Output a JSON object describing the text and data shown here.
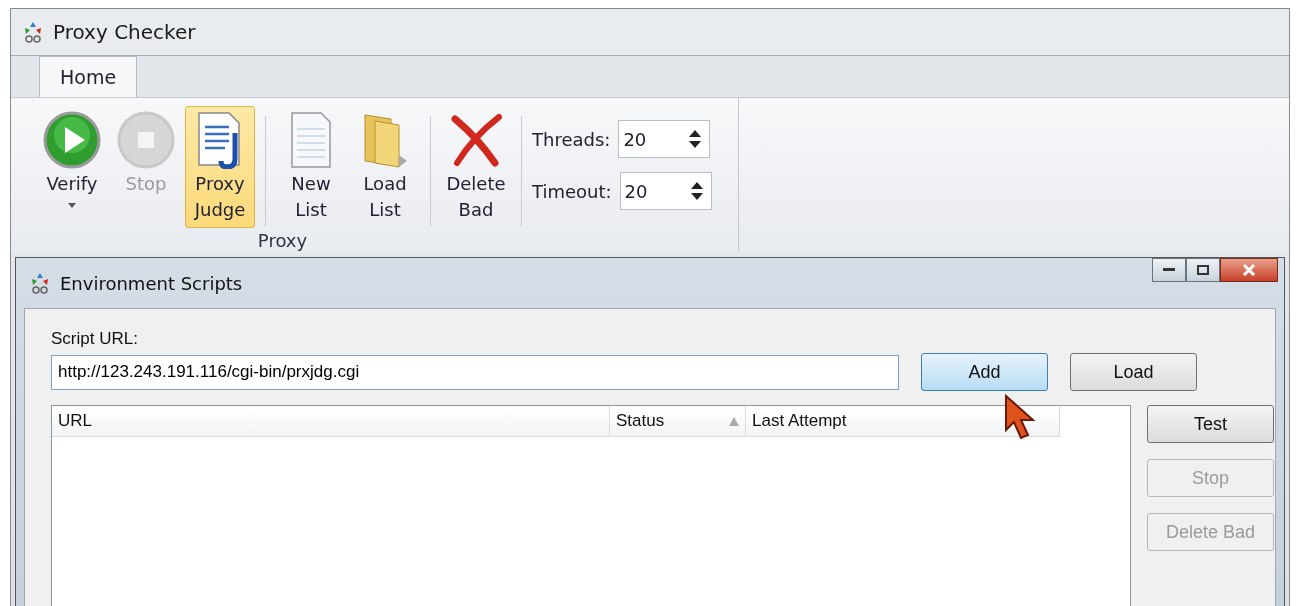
{
  "window": {
    "title": "Proxy Checker"
  },
  "ribbon": {
    "tabs": [
      {
        "label": "Home",
        "selected": true
      }
    ],
    "buttons": [
      {
        "label": "Verify",
        "disabled": false,
        "pressed": false,
        "dropdown": true
      },
      {
        "label": "Stop",
        "disabled": true,
        "pressed": false,
        "dropdown": false
      },
      {
        "label": "Proxy Judge",
        "disabled": false,
        "pressed": true,
        "dropdown": false
      },
      {
        "label": "New List",
        "disabled": false,
        "pressed": false,
        "dropdown": false
      },
      {
        "label": "Load List",
        "disabled": false,
        "pressed": false,
        "dropdown": false
      },
      {
        "label": "Delete Bad",
        "disabled": false,
        "pressed": false,
        "dropdown": false
      }
    ],
    "group_label": "Proxy",
    "spinners": [
      {
        "label": "Threads:",
        "value": "20"
      },
      {
        "label": "Timeout:",
        "value": "20"
      }
    ]
  },
  "dialog": {
    "title": "Environment Scripts",
    "field_label": "Script URL:",
    "field_value": "http://123.243.191.116/cgi-bin/prxjdg.cgi",
    "url_buttons": [
      {
        "label": "Add",
        "hovered": true
      },
      {
        "label": "Load",
        "hovered": false
      }
    ],
    "columns": [
      {
        "label": "URL",
        "sorted": false
      },
      {
        "label": "Status",
        "sorted": true
      },
      {
        "label": "Last Attempt",
        "sorted": false
      }
    ],
    "side_buttons": [
      {
        "label": "Test",
        "disabled": false
      },
      {
        "label": "Stop",
        "disabled": true
      },
      {
        "label": "Delete Bad",
        "disabled": true
      }
    ]
  }
}
